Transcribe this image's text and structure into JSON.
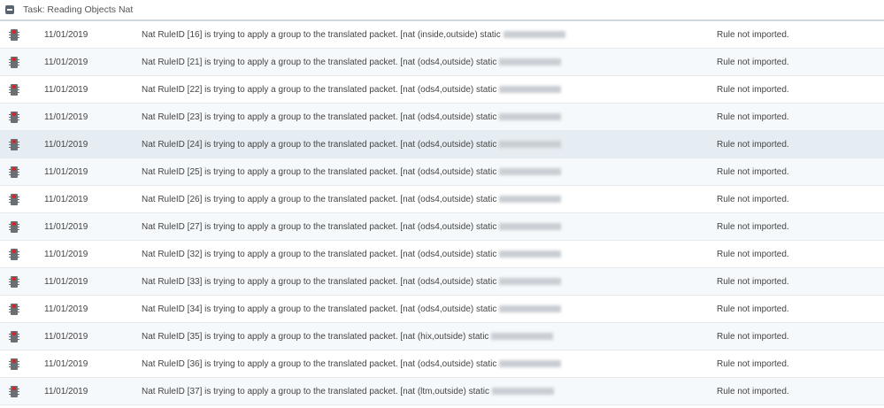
{
  "task": {
    "title": "Task: Reading Objects Nat"
  },
  "rows": [
    {
      "date": "11/01/2019",
      "message": "Nat RuleID [16] is trying to apply a group to the translated packet. [nat (inside,outside) static",
      "result": "Rule not imported."
    },
    {
      "date": "11/01/2019",
      "message": "Nat RuleID [21] is trying to apply a group to the translated packet. [nat (ods4,outside) static",
      "result": "Rule not imported."
    },
    {
      "date": "11/01/2019",
      "message": "Nat RuleID [22] is trying to apply a group to the translated packet. [nat (ods4,outside) static",
      "result": "Rule not imported."
    },
    {
      "date": "11/01/2019",
      "message": "Nat RuleID [23] is trying to apply a group to the translated packet. [nat (ods4,outside) static",
      "result": "Rule not imported."
    },
    {
      "date": "11/01/2019",
      "message": "Nat RuleID [24] is trying to apply a group to the translated packet. [nat (ods4,outside) static",
      "result": "Rule not imported."
    },
    {
      "date": "11/01/2019",
      "message": "Nat RuleID [25] is trying to apply a group to the translated packet. [nat (ods4,outside) static",
      "result": "Rule not imported."
    },
    {
      "date": "11/01/2019",
      "message": "Nat RuleID [26] is trying to apply a group to the translated packet. [nat (ods4,outside) static",
      "result": "Rule not imported."
    },
    {
      "date": "11/01/2019",
      "message": "Nat RuleID [27] is trying to apply a group to the translated packet. [nat (ods4,outside) static",
      "result": "Rule not imported."
    },
    {
      "date": "11/01/2019",
      "message": "Nat RuleID [32] is trying to apply a group to the translated packet. [nat (ods4,outside) static",
      "result": "Rule not imported."
    },
    {
      "date": "11/01/2019",
      "message": "Nat RuleID [33] is trying to apply a group to the translated packet. [nat (ods4,outside) static",
      "result": "Rule not imported."
    },
    {
      "date": "11/01/2019",
      "message": "Nat RuleID [34] is trying to apply a group to the translated packet. [nat (ods4,outside) static",
      "result": "Rule not imported."
    },
    {
      "date": "11/01/2019",
      "message": "Nat RuleID [35] is trying to apply a group to the translated packet. [nat (hix,outside) static",
      "result": "Rule not imported."
    },
    {
      "date": "11/01/2019",
      "message": "Nat RuleID [36] is trying to apply a group to the translated packet. [nat (ods4,outside) static",
      "result": "Rule not imported."
    },
    {
      "date": "11/01/2019",
      "message": "Nat RuleID [37] is trying to apply a group to the translated packet. [nat (ltm,outside) static",
      "result": "Rule not imported."
    }
  ]
}
